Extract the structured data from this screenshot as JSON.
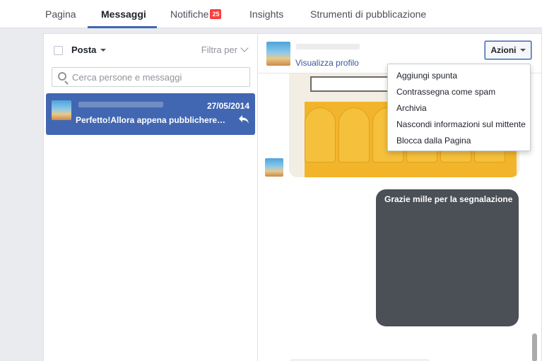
{
  "tabs": [
    {
      "label": "Pagina"
    },
    {
      "label": "Messaggi",
      "active": true
    },
    {
      "label": "Notifiche",
      "badge": "25"
    },
    {
      "label": "Insights"
    },
    {
      "label": "Strumenti di pubblicazione"
    }
  ],
  "inbox": {
    "folder_label": "Posta",
    "filter_label": "Filtra per",
    "search_placeholder": "Cerca persone e messaggi",
    "conversations": [
      {
        "date": "27/05/2014",
        "snippet": "Perfetto!Allora appena pubblicheremo l'...",
        "replied": true
      }
    ]
  },
  "conversation": {
    "view_profile_label": "Visualizza profilo",
    "actions_label": "Azioni",
    "outgoing_message": "Grazie mille per la segnalazione"
  },
  "actions_menu": [
    "Aggiungi spunta",
    "Contrassegna come spam",
    "Archivia",
    "Nascondi informazioni sul mittente",
    "Blocca dalla Pagina"
  ],
  "colors": {
    "accent": "#4267b2",
    "badge": "#fa3e3e",
    "outgoing_bubble": "#4b4f56"
  }
}
